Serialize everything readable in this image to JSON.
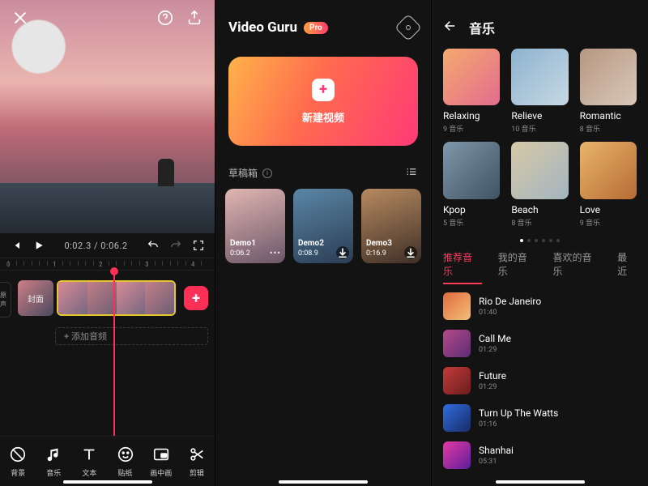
{
  "editor": {
    "time_current": "0:02.3",
    "time_total": "0:06.2",
    "ruler_labels": [
      "0",
      "1",
      "2",
      "3",
      "4"
    ],
    "cover_label": "封面",
    "side_label": "原声",
    "add_audio_label": "+ 添加音频",
    "tools": [
      {
        "key": "bg",
        "label": "背景"
      },
      {
        "key": "music",
        "label": "音乐"
      },
      {
        "key": "text",
        "label": "文本"
      },
      {
        "key": "sticker",
        "label": "贴纸"
      },
      {
        "key": "pip",
        "label": "画中画"
      },
      {
        "key": "cut",
        "label": "剪辑"
      }
    ]
  },
  "home": {
    "brand": "Video Guru",
    "pro_badge": "Pro",
    "new_project_label": "新建视频",
    "drafts_label": "草稿箱",
    "drafts": [
      {
        "name": "Demo1",
        "duration": "0:06.2",
        "has_more": true
      },
      {
        "name": "Demo2",
        "duration": "0:08.9",
        "has_download": true
      },
      {
        "name": "Demo3",
        "duration": "0:16.9",
        "has_download": true
      }
    ]
  },
  "music": {
    "title": "音乐",
    "count_suffix": "音乐",
    "categories": [
      {
        "key": "relaxing",
        "name": "Relaxing",
        "count": "9"
      },
      {
        "key": "relieve",
        "name": "Relieve",
        "count": "10"
      },
      {
        "key": "romantic",
        "name": "Romantic",
        "count": "8"
      },
      {
        "key": "kpop",
        "name": "Kpop",
        "count": "5"
      },
      {
        "key": "beach",
        "name": "Beach",
        "count": "8"
      },
      {
        "key": "love",
        "name": "Love",
        "count": "9"
      }
    ],
    "page_dots": 6,
    "active_dot": 0,
    "tabs": [
      "推荐音乐",
      "我的音乐",
      "喜欢的音乐",
      "最近"
    ],
    "active_tab": 0,
    "songs": [
      {
        "title": "Rio De Janeiro",
        "duration": "01:40"
      },
      {
        "title": "Call Me",
        "duration": "01:29"
      },
      {
        "title": "Future",
        "duration": "01:29"
      },
      {
        "title": "Turn Up The Watts",
        "duration": "01:16"
      },
      {
        "title": "Shanhai",
        "duration": "05:31"
      }
    ]
  }
}
